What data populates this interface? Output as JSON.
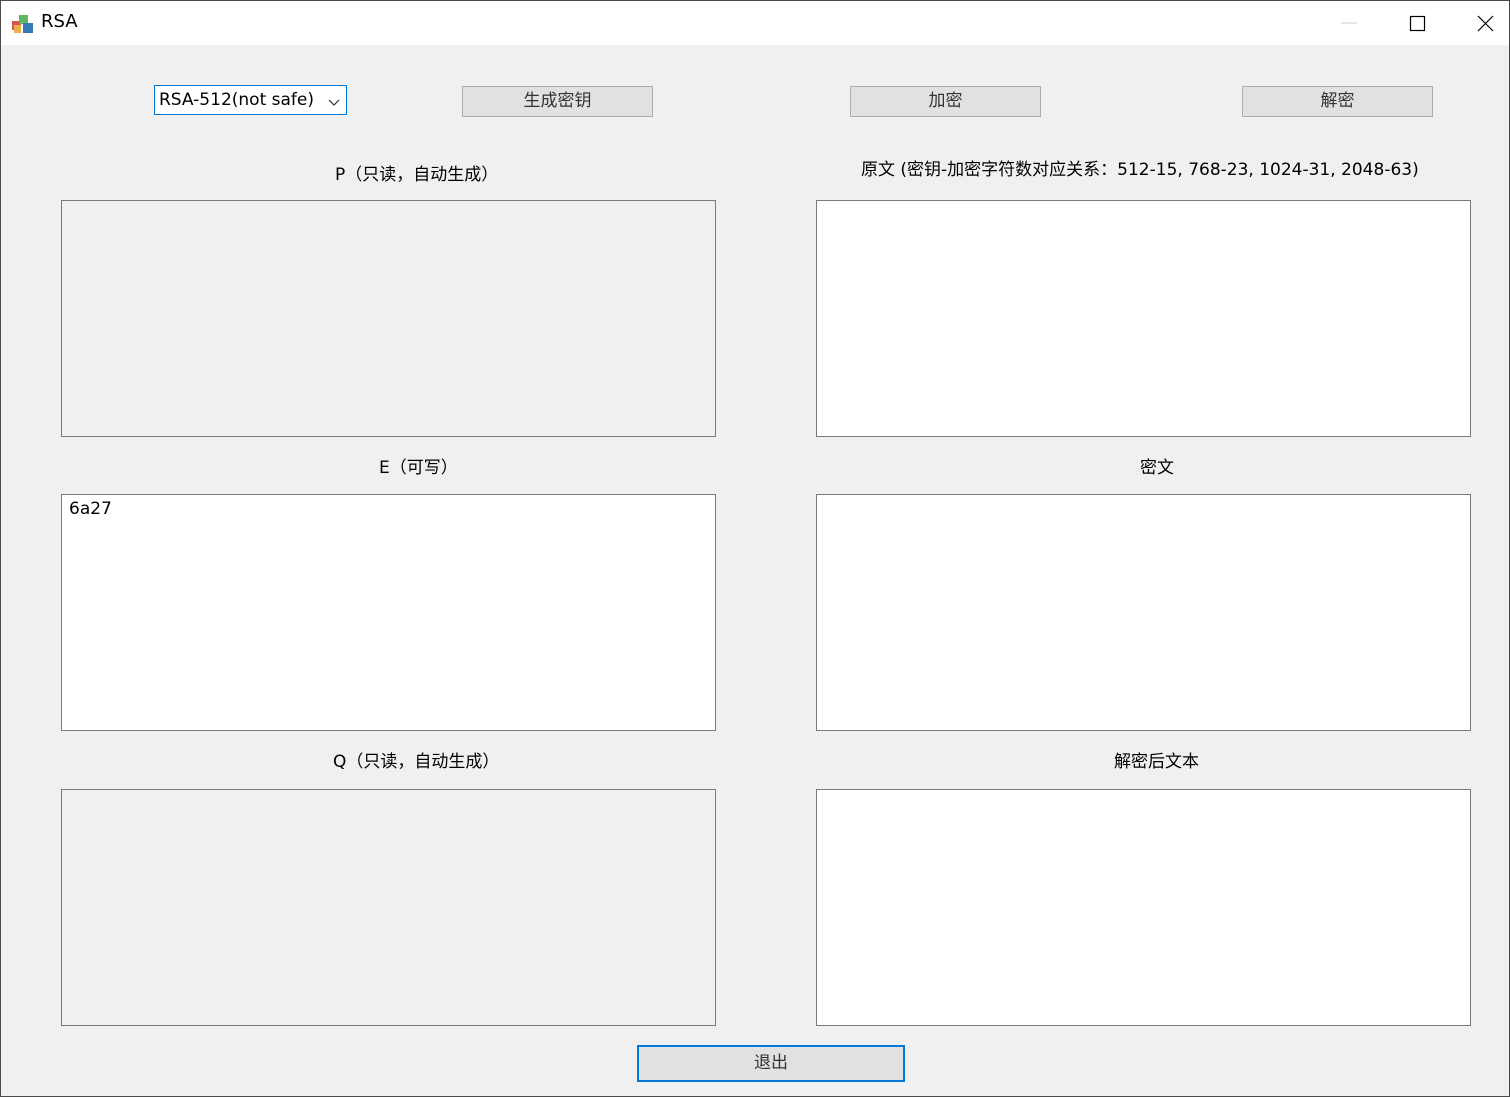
{
  "window": {
    "title": "RSA",
    "icon": "rsa-app-icon"
  },
  "toolbar": {
    "key_size_selected": "RSA-512(not safe)",
    "generate_key_label": "生成密钥",
    "encrypt_label": "加密",
    "decrypt_label": "解密"
  },
  "left_panel": {
    "p_label": "P（只读，自动生成）",
    "p_value": "",
    "e_label": "E（可写）",
    "e_value": "6a27",
    "q_label": "Q（只读，自动生成）",
    "q_value": ""
  },
  "right_panel": {
    "plaintext_label": "原文 (密钥-加密字符数对应关系：512-15, 768-23, 1024-31, 2048-63)",
    "plaintext_value": "",
    "ciphertext_label": "密文",
    "ciphertext_value": "",
    "decrypted_label": "解密后文本",
    "decrypted_value": ""
  },
  "footer": {
    "exit_label": "退出"
  },
  "colors": {
    "focus_border": "#0078d7",
    "window_bg": "#f0f0f0",
    "button_bg": "#e1e1e1"
  }
}
